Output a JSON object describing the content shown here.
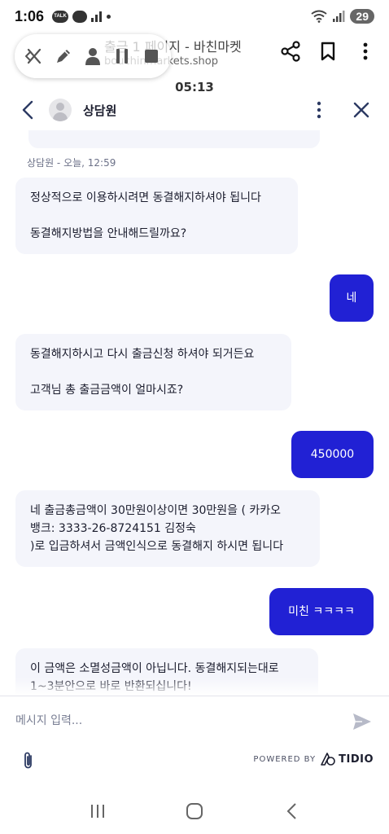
{
  "status_bar": {
    "time": "1:06",
    "talk_badge": "TALK",
    "battery": "29"
  },
  "browser": {
    "page_title": "출금 1 페이지 - 바친마켓",
    "url": "bouchinmarkets.shop"
  },
  "timer": "05:13",
  "chat_header": {
    "agent_name": "상담원"
  },
  "messages": {
    "meta": "상담원 - 오늘, 12:59",
    "items": [
      {
        "sender": "operator",
        "text": "정상적으로 이용하시려면 동결해지하셔야 됩니다\n\n동결해지방법을 안내해드릴까요?"
      },
      {
        "sender": "visitor",
        "text": "네"
      },
      {
        "sender": "operator",
        "text": "동결해지하시고 다시 출금신청 하셔야 되거든요\n\n고객님 총 출금금액이 얼마시죠?"
      },
      {
        "sender": "visitor",
        "text": "450000"
      },
      {
        "sender": "operator",
        "text": "네 출금총금액이 30만원이상이면 30만원을 ( 카카오\n뱅크: 3333-26-8724151 김정숙\n)로 입금하셔서 금액인식으로 동결해지 하시면 됩니다"
      },
      {
        "sender": "visitor",
        "text": "미친 ㅋㅋㅋㅋ"
      },
      {
        "sender": "operator",
        "text": "이 금액은 소멸성금액이 아닙니다. 동결해지되는대로\n1~3분안으로 바로 반환되십니다!"
      }
    ]
  },
  "input": {
    "placeholder": "메시지 입력..."
  },
  "footer": {
    "powered_by": "POWERED BY",
    "brand": "TIDIO"
  },
  "colors": {
    "visitor_bubble": "#2121d4",
    "operator_bubble": "#f4f5fb",
    "text": "#1b1d2e"
  }
}
